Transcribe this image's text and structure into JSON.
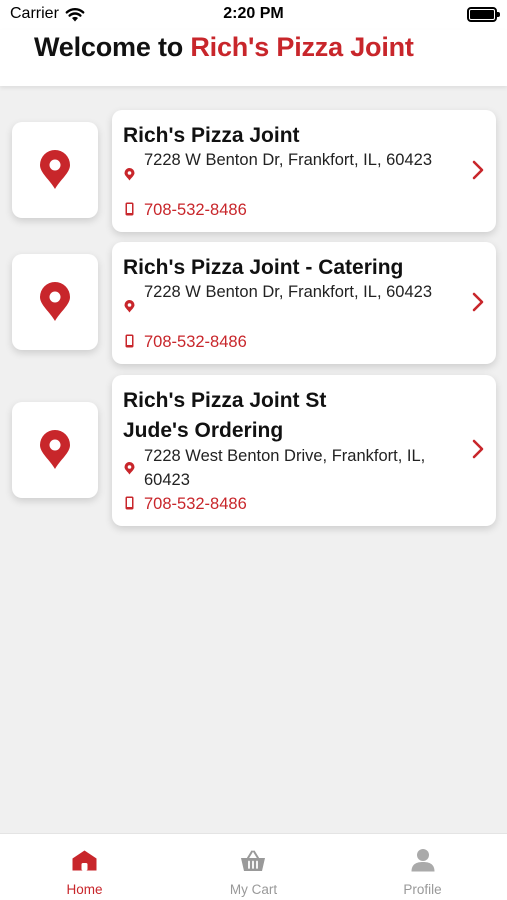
{
  "status_bar": {
    "carrier": "Carrier",
    "time": "2:20 PM"
  },
  "header": {
    "prefix": "Welcome to ",
    "brand": "Rich's Pizza Joint"
  },
  "locations": [
    {
      "name": "Rich's Pizza Joint",
      "address": "7228 W Benton Dr, Frankfort, IL, 60423",
      "phone": "708-532-8486"
    },
    {
      "name": "Rich's Pizza Joint - Catering",
      "address": "7228 W Benton Dr, Frankfort, IL, 60423",
      "phone": "708-532-8486"
    },
    {
      "name": "Rich's Pizza Joint St Jude's Ordering",
      "address": "7228 West Benton Drive, Frankfort, IL, 60423",
      "phone": "708-532-8486"
    }
  ],
  "tabs": [
    {
      "label": "Home",
      "icon": "home-icon",
      "active": true
    },
    {
      "label": "My Cart",
      "icon": "cart-icon",
      "active": false
    },
    {
      "label": "Profile",
      "icon": "profile-icon",
      "active": false
    }
  ],
  "colors": {
    "accent": "#c8262b",
    "inactive": "#999999"
  }
}
